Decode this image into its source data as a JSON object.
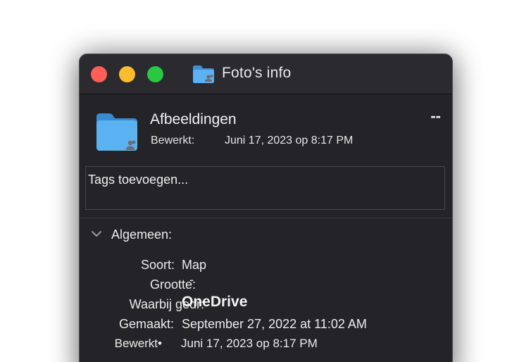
{
  "window": {
    "title": "Foto's info",
    "title_icon": "shared-folder-icon"
  },
  "header": {
    "name": "Afbeeldingen",
    "size": "--",
    "modified_label": "Bewerkt:",
    "modified_value": "Juni 17, 2023 op 8:17 PM",
    "icon": "shared-folder-icon"
  },
  "tags": {
    "placeholder": "Tags toevoegen..."
  },
  "general": {
    "section_label": "Algemeen:",
    "toggle_icon": "chevron-down-icon",
    "rows": [
      {
        "label": "Soort:",
        "value": "Map"
      },
      {
        "label": "Grootte:",
        "value": "-"
      },
      {
        "label": "Waarbij gedr:",
        "value": "OneDrive"
      },
      {
        "label": "Gemaakt:",
        "value": "September 27, 2022 at 11:02 AM"
      },
      {
        "label": "Bewerkt•",
        "value": "Juni 17, 2023 op 8:17 PM"
      }
    ]
  },
  "colors": {
    "window_bg": "#242327",
    "titlebar_bg": "#2b2a2e",
    "close": "#ff5f57",
    "minimize": "#febc2e",
    "zoom": "#28c840",
    "folder_blue": "#4aa3e8"
  }
}
